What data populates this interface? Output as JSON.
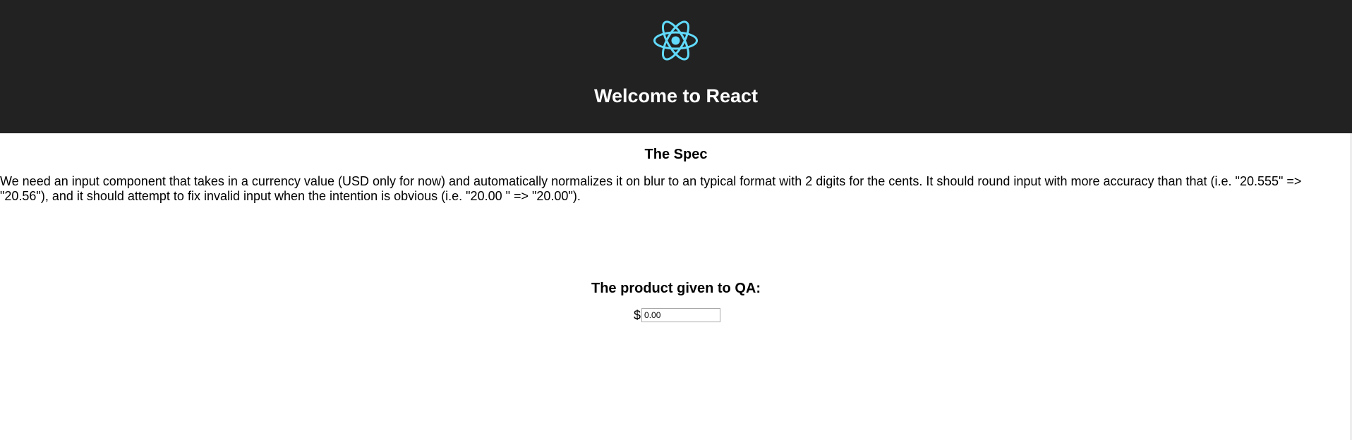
{
  "header": {
    "title": "Welcome to React",
    "logo": "react-logo-icon",
    "background_color": "#222222",
    "logo_color": "#61dafb"
  },
  "spec": {
    "title": "The Spec",
    "body": "We need an input component that takes in a currency value (USD only for now) and automatically normalizes it on blur to an typical format with 2 digits for the cents. It should round input with more accuracy than that (i.e. \"20.555\" => \"20.56\"), and it should attempt to fix invalid input when the intention is obvious (i.e. \"20.00 \" => \"20.00\")."
  },
  "qa": {
    "title": "The product given to QA:",
    "currency_symbol": "$",
    "input_value": "0.00"
  }
}
